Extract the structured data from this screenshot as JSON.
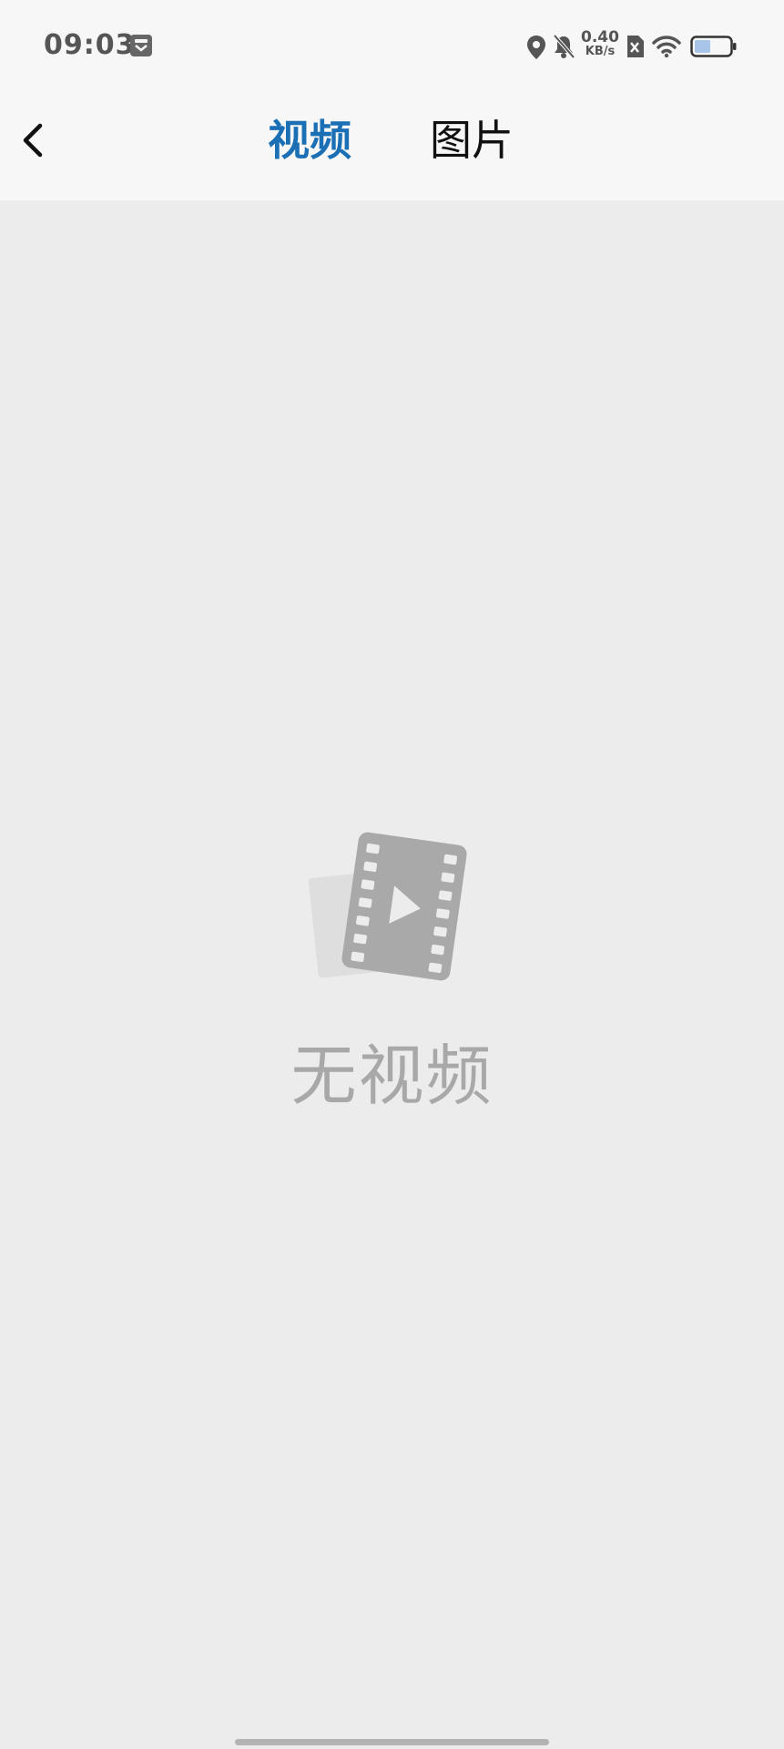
{
  "status_bar": {
    "time": "09:03",
    "net_speed_value": "0.40",
    "net_speed_unit": "KB/s",
    "battery_level": 0.45,
    "icons": [
      "app-notification-icon",
      "location-icon",
      "bell-muted-icon",
      "sim-disabled-icon",
      "wifi-icon",
      "battery-icon"
    ]
  },
  "nav": {
    "back_icon": "chevron-left-icon",
    "tabs": [
      {
        "label": "视频",
        "active": true
      },
      {
        "label": "图片",
        "active": false
      }
    ]
  },
  "empty_state": {
    "icon": "video-film-icon",
    "message": "无视频"
  },
  "colors": {
    "accent": "#1a6fb5",
    "header_bg": "#f7f7f7",
    "page_bg": "#ececec",
    "muted_text": "#a8a8a8"
  }
}
